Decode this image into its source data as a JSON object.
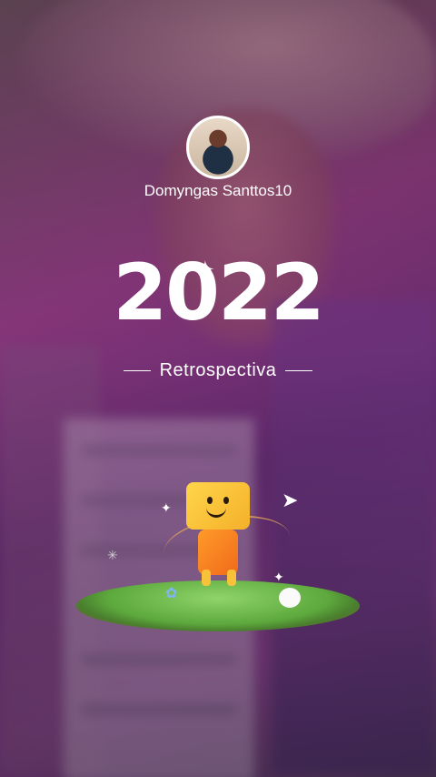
{
  "profile": {
    "username": "Domyngas Santtos10"
  },
  "header": {
    "year": "2022",
    "subtitle": "Retrospectiva"
  },
  "icons": {
    "sparkle": "sparkle-icon",
    "plane": "paper-plane-icon"
  },
  "colors": {
    "text": "#ffffff",
    "mascot_head": "#ffd54a",
    "mascot_body": "#f06a1a",
    "grass": "#5da93d"
  }
}
